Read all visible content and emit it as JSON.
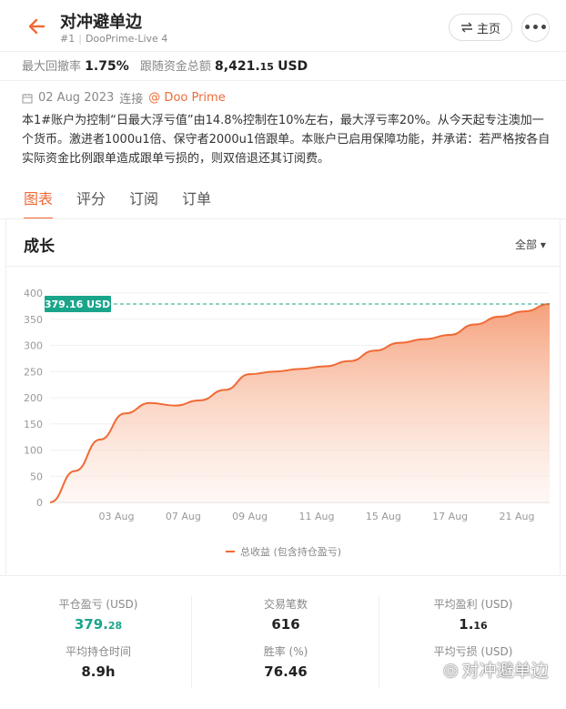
{
  "header": {
    "title": "对冲避单边",
    "rank": "#1",
    "account": "DooPrime-Live 4",
    "home_label": "主页",
    "more_label": "•••"
  },
  "stats": {
    "max_drawdown_label": "最大回撤率",
    "max_drawdown_value": "1.75%",
    "follow_funds_label": "跟随资金总额",
    "follow_funds_int": "8,421.",
    "follow_funds_dec": "15",
    "follow_funds_unit": "USD"
  },
  "connection": {
    "date": "02 Aug 2023",
    "connect_label": "连接",
    "broker": "@ Doo Prime"
  },
  "description": "本1#账户为控制“日最大浮亏值”由14.8%控制在10%左右，最大浮亏率20%。从今天起专注澳加一个货币。激进者1000u1倍、保守者2000u1倍跟单。本账户已启用保障功能，并承诺：若严格按各自实际资金比例跟单造成跟单亏损的，则双倍退还其订阅费。",
  "tabs": [
    {
      "label": "图表",
      "active": true
    },
    {
      "label": "评分",
      "active": false
    },
    {
      "label": "订阅",
      "active": false
    },
    {
      "label": "订单",
      "active": false
    }
  ],
  "growth": {
    "title": "成长",
    "range": "全部",
    "legend": "总收益 (包含持仓盈亏)"
  },
  "chart_data": {
    "type": "area",
    "y_ticks": [
      "0",
      "50",
      "100",
      "150",
      "200",
      "250",
      "300",
      "350",
      "400"
    ],
    "ylim": [
      0,
      400
    ],
    "x_ticks": [
      "03 Aug",
      "07 Aug",
      "09 Aug",
      "11 Aug",
      "15 Aug",
      "17 Aug",
      "21 Aug"
    ],
    "current_label": "379.16 USD",
    "current_value": 379.16,
    "series": [
      {
        "values": [
          0,
          60,
          120,
          170,
          190,
          185,
          195,
          215,
          245,
          250,
          255,
          260,
          270,
          290,
          305,
          312,
          320,
          340,
          355,
          365,
          379.16
        ]
      }
    ],
    "colors": {
      "line": "#f06a35",
      "fill_top": "#f6a07b",
      "fill_bottom": "#fdf1ea",
      "ref_line": "#1aa58b"
    },
    "grid": true
  },
  "metrics": {
    "floating_pl_label": "平仓盈亏 (USD)",
    "floating_pl_int": "379.",
    "floating_pl_dec": "28",
    "trades_label": "交易笔数",
    "trades_value": "616",
    "avg_profit_label": "平均盈利 (USD)",
    "avg_profit_int": "1.",
    "avg_profit_dec": "16",
    "avg_hold_label": "平均持仓时间",
    "avg_hold_value": "8.9h",
    "win_rate_label": "胜率 (%)",
    "win_rate_value": "76.46",
    "avg_loss_label": "平均亏损 (USD)"
  },
  "watermark": "对冲避单边"
}
